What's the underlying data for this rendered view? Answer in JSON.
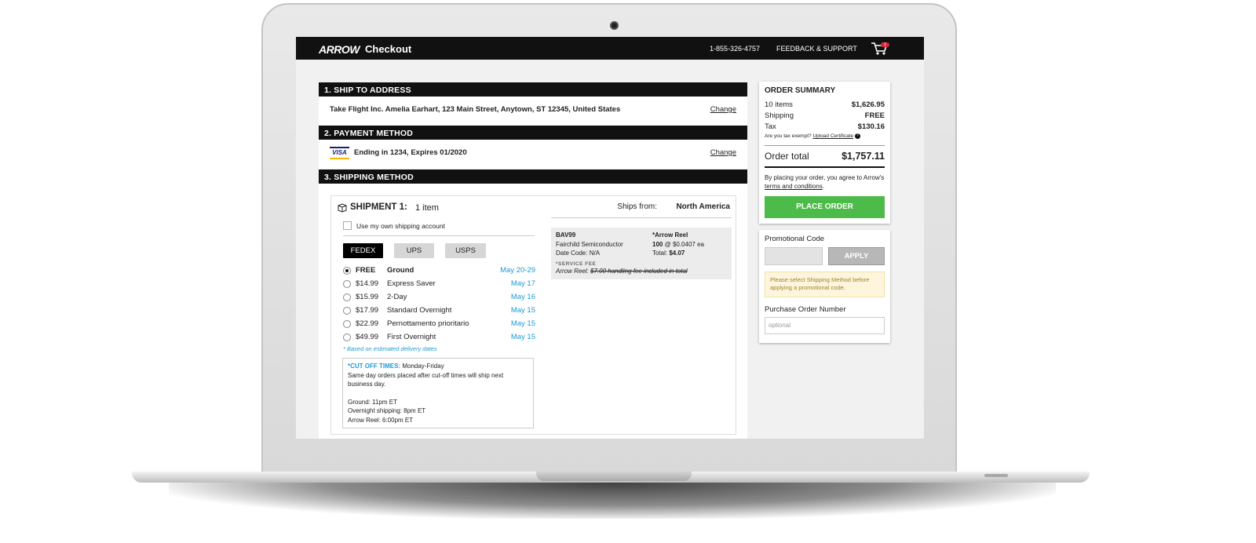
{
  "header": {
    "logo": "ARROW",
    "title": "Checkout",
    "phone": "1-855-326-4757",
    "support": "FEEDBACK & SUPPORT",
    "cart_count": "1"
  },
  "sections": {
    "ship_to": {
      "title": "1. SHIP TO ADDRESS",
      "address": "Take Flight Inc. Amelia Earhart, 123 Main Street, Anytown, ST 12345, United States",
      "change": "Change"
    },
    "payment": {
      "title": "2. PAYMENT METHOD",
      "card_brand": "VISA",
      "card": "Ending in 1234, Expires 01/2020",
      "change": "Change"
    },
    "shipping": {
      "title": "3. SHIPPING METHOD"
    }
  },
  "shipment": {
    "title": "SHIPMENT 1:",
    "count": "1 item",
    "ships_from_label": "Ships from:",
    "ships_from": "North America",
    "own_account": "Use my own shipping account",
    "carriers": [
      "FEDEX",
      "UPS",
      "USPS"
    ],
    "options": [
      {
        "price": "FREE",
        "name": "Ground",
        "date": "May 20-29",
        "selected": true
      },
      {
        "price": "$14.99",
        "name": "Express Saver",
        "date": "May 17"
      },
      {
        "price": "$15.99",
        "name": "2-Day",
        "date": "May 16"
      },
      {
        "price": "$17.99",
        "name": "Standard Overnight",
        "date": "May 15"
      },
      {
        "price": "$22.99",
        "name": "Pernottamento prioritario",
        "date": "May 15"
      },
      {
        "price": "$49.99",
        "name": "First Overnight",
        "date": "May 15"
      }
    ],
    "note": "* Based on estimated delivery dates",
    "cutoff": {
      "heading": "*CUT OFF TIMES:",
      "days": "Monday-Friday",
      "line1": "Same day orders placed after cut-off times will ship next business day.",
      "ground": "Ground: 11pm ET",
      "overnight": "Overnight shipping: 8pm ET",
      "reel": "Arrow Reel: 6:00pm ET"
    },
    "item": {
      "part": "BAV99",
      "maker": "Fairchild Semiconductor",
      "date_code": "Date Code: N/A",
      "reel": "*Arrow Reel",
      "qty": "100",
      "unit": "@ $0.0407 ea",
      "total_label": "Total:",
      "total": "$4.07",
      "fee_label": "*SERVICE FEE",
      "fee_prefix": "Arrow Reel:",
      "fee_text": "$7.00 handling fee included in total"
    }
  },
  "summary": {
    "title": "ORDER SUMMARY",
    "items_label": "10 items",
    "items_value": "$1,626.95",
    "shipping_label": "Shipping",
    "shipping_value": "FREE",
    "tax_label": "Tax",
    "tax_value": "$130.16",
    "tax_question": "Are you tax exempt?",
    "upload": "Upload Certificate",
    "total_label": "Order total",
    "total_value": "$1,757.11",
    "agree_text": "By placing your order, you agree to Arrow's",
    "terms": "terms and conditions",
    "place_order": "PLACE ORDER"
  },
  "promo": {
    "label": "Promotional Code",
    "apply": "APPLY",
    "warning": "Please select Shipping Method before applying a promotional code.",
    "po_label": "Purchase Order Number",
    "po_placeholder": "optional"
  }
}
